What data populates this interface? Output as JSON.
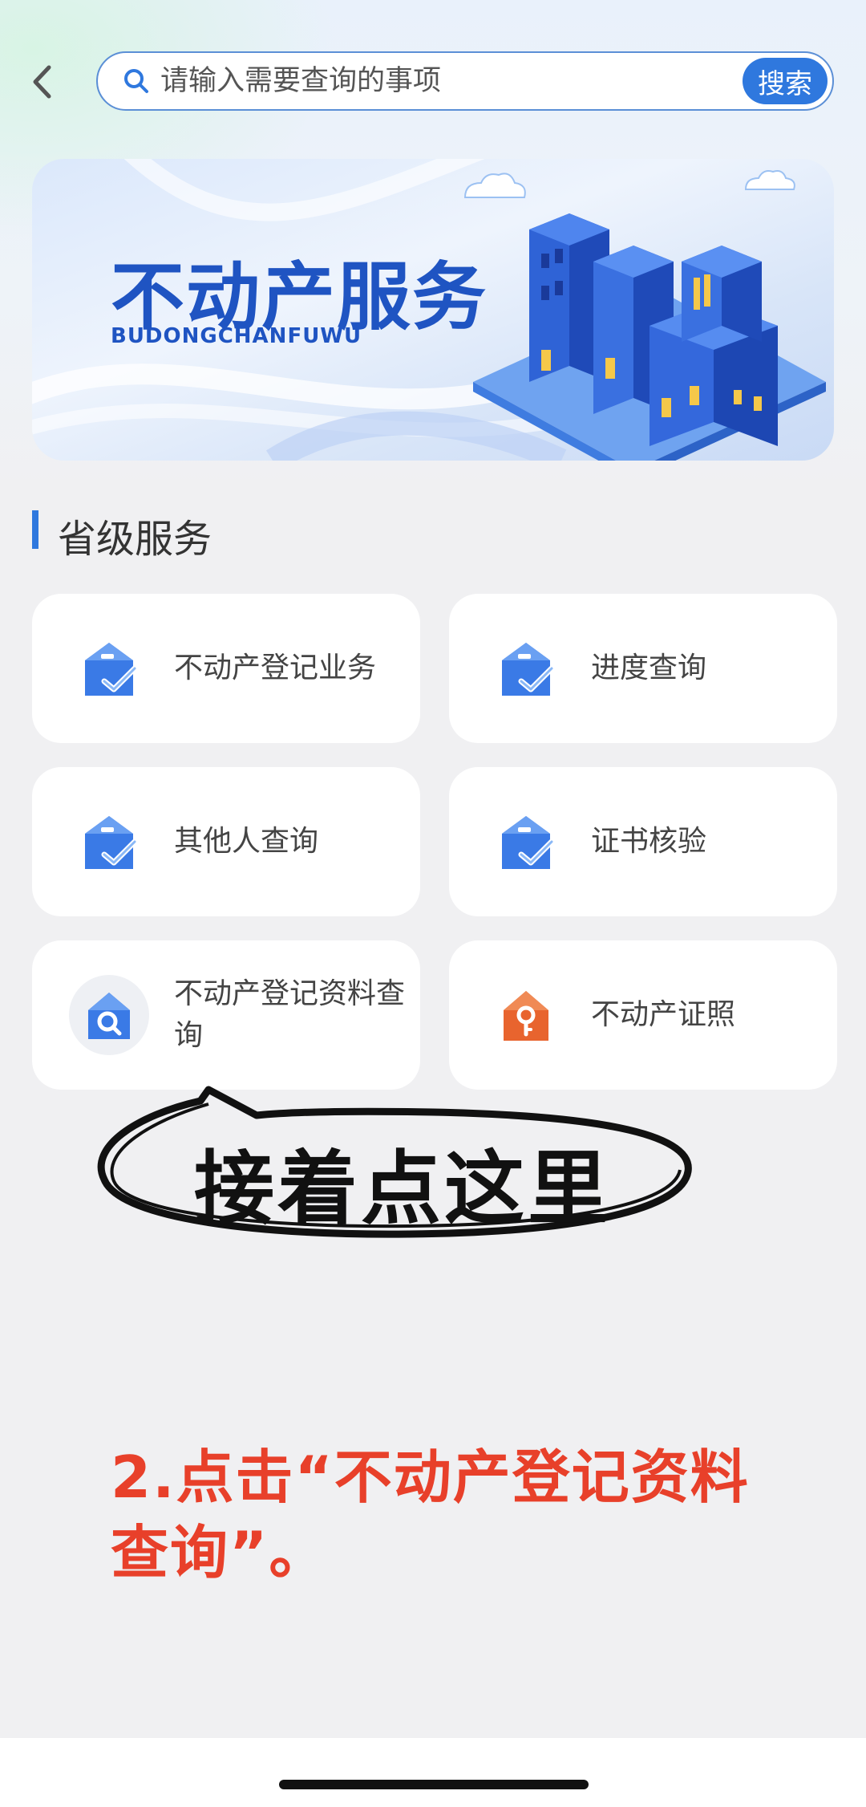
{
  "header": {
    "search_placeholder": "请输入需要查询的事项",
    "search_button": "搜索"
  },
  "banner": {
    "title": "不动产服务",
    "subtitle": "BUDONGCHANFUWU"
  },
  "section": {
    "title": "省级服务"
  },
  "services": [
    {
      "label": "不动产登记业务",
      "icon": "house-check-icon"
    },
    {
      "label": "进度查询",
      "icon": "house-check-icon"
    },
    {
      "label": "其他人查询",
      "icon": "house-check-icon"
    },
    {
      "label": "证书核验",
      "icon": "house-check-icon"
    },
    {
      "label": "不动产登记资料查询",
      "icon": "house-search-icon"
    },
    {
      "label": "不动产证照",
      "icon": "house-key-icon"
    }
  ],
  "annotation": {
    "callout": "接着点这里",
    "instruction": "2.点击“不动产登记资料查询”。"
  },
  "colors": {
    "accent": "#2f78de",
    "instruction": "#e8402a",
    "key_icon": "#e8642e"
  }
}
